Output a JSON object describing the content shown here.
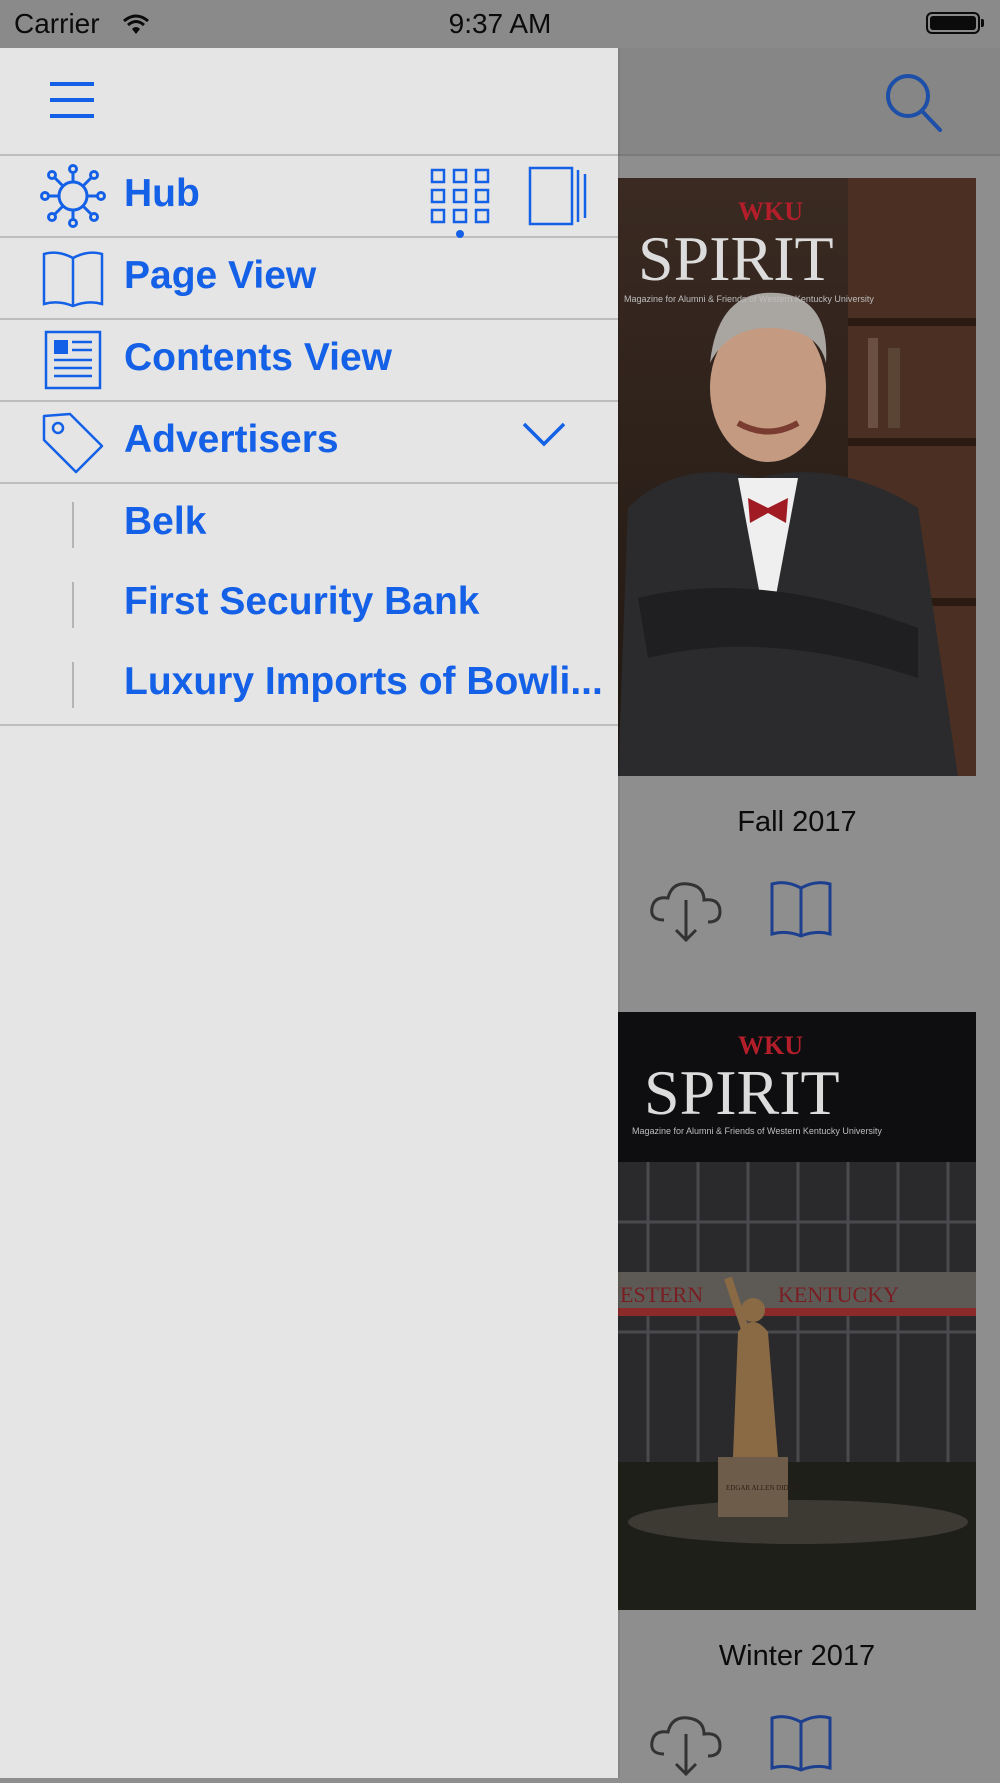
{
  "status_bar": {
    "carrier": "Carrier",
    "time": "9:37 AM"
  },
  "drawer": {
    "items": [
      {
        "label": "Hub",
        "icon": "hub-icon"
      },
      {
        "label": "Page View",
        "icon": "open-book-icon"
      },
      {
        "label": "Contents View",
        "icon": "contents-icon"
      },
      {
        "label": "Advertisers",
        "icon": "tag-icon"
      }
    ],
    "advertisers": [
      "Belk",
      "First Security Bank",
      "Luxury Imports of Bowli..."
    ]
  },
  "issues": [
    {
      "label": "Fall 2017",
      "cover_brand": "WKU",
      "cover_title": "SPIRIT",
      "cover_tagline": "Magazine for Alumni & Friends of Western Kentucky University"
    },
    {
      "label": "Winter 2017",
      "cover_brand": "WKU",
      "cover_title": "SPIRIT",
      "cover_tagline": "Magazine for Alumni & Friends of Western Kentucky University",
      "cover_sign_left": "ESTERN",
      "cover_sign_right": "KENTUCKY",
      "cover_statue": "EDGAR ALLEN DIDDLE"
    }
  ],
  "colors": {
    "accent": "#1460e6",
    "drawer_bg": "#e5e5e5",
    "dim_bg": "#8e8e8e"
  }
}
